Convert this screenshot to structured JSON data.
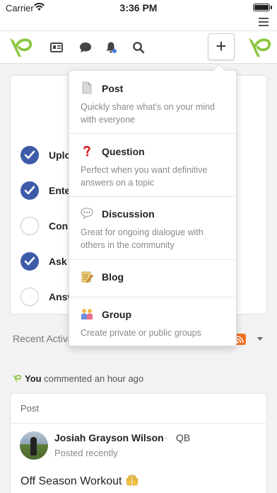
{
  "status_bar": {
    "carrier": "Carrier",
    "time": "3:36 PM"
  },
  "checklist": {
    "items": [
      {
        "label": "Uplo",
        "done": true
      },
      {
        "label": "Ente",
        "done": true
      },
      {
        "label": "Conn",
        "done": false
      },
      {
        "label": "Ask a",
        "done": true
      },
      {
        "label": "Answ",
        "done": false
      }
    ]
  },
  "activity": {
    "label": "Recent Activit"
  },
  "comment_meta": {
    "actor": "You",
    "action": "commented an hour ago"
  },
  "post_card": {
    "type_label": "Post",
    "author": "Josiah Grayson Wilson",
    "separator": "·",
    "position": "QB",
    "posted": "Posted recently",
    "text": "Off Season Workout"
  },
  "create_menu": {
    "items": [
      {
        "title": "Post",
        "description": "Quickly share what's on your mind with everyone",
        "icon": "document-icon"
      },
      {
        "title": "Question",
        "description": "Perfect when you want definitive answers on a topic",
        "icon": "question-mark-icon"
      },
      {
        "title": "Discussion",
        "description": "Great for ongoing dialogue with others in the community",
        "icon": "speech-bubble-icon"
      },
      {
        "title": "Blog",
        "description": "",
        "icon": "memo-icon"
      },
      {
        "title": "Group",
        "description": "Create private or public groups",
        "icon": "people-icon"
      }
    ]
  },
  "colors": {
    "brand_green": "#8cc63f",
    "check_blue": "#3d5ba9",
    "rss_orange": "#f37021"
  }
}
